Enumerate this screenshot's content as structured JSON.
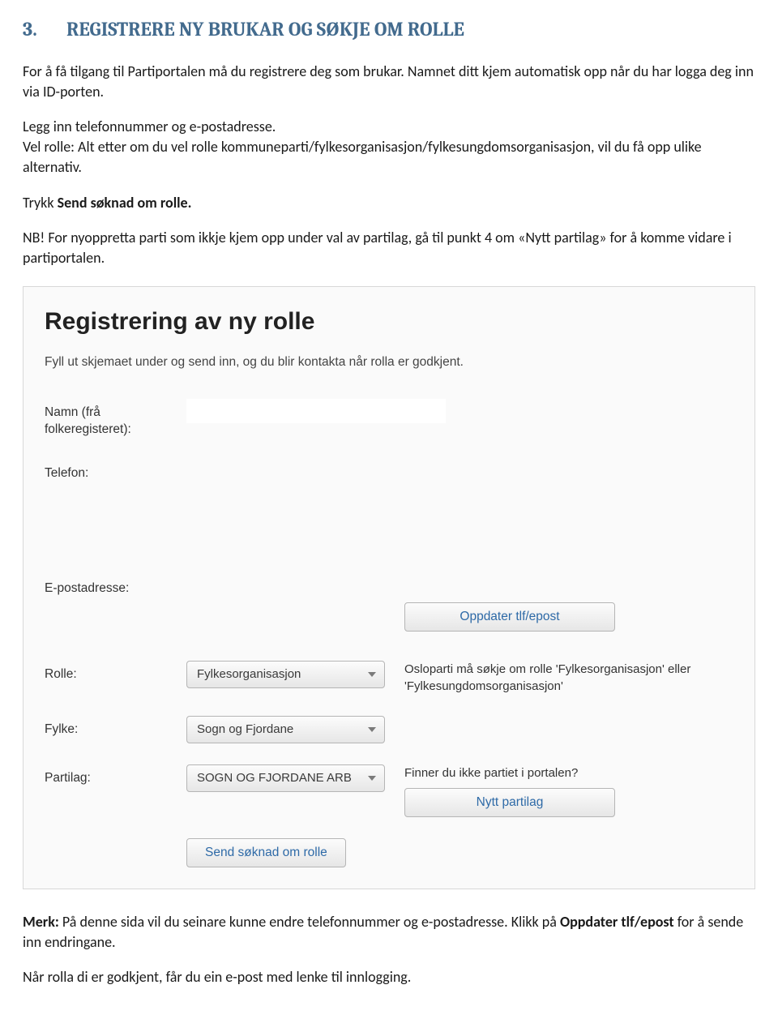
{
  "heading": {
    "number": "3.",
    "title": "REGISTRERE NY BRUKAR OG SØKJE OM ROLLE"
  },
  "paragraphs": {
    "p1": "For å få tilgang til Partiportalen må du registrere deg som brukar. Namnet ditt kjem automatisk opp når du har logga deg inn via ID-porten.",
    "p2": "Legg inn telefonnummer og e-postadresse.",
    "p3": "Vel rolle: Alt etter om du vel rolle kommuneparti/fylkesorganisasjon/fylkesungdomsorganisasjon, vil du få opp ulike alternativ.",
    "p4_pre": "Trykk ",
    "p4_bold": "Send søknad om rolle.",
    "p5": "NB! For nyoppretta parti som ikkje kjem opp under val av partilag, gå til punkt 4 om «Nytt partilag» for å komme vidare i partiportalen.",
    "merk_label": "Merk:",
    "merk_body1": " På denne sida vil du  seinare kunne endre telefonnummer og e-postadresse. Klikk på ",
    "merk_bold": "Oppdater tlf/epost",
    "merk_body2": " for å sende inn endringane.",
    "p_last": "Når rolla di er godkjent, får du ein e-post med lenke til innlogging."
  },
  "form": {
    "title": "Registrering av ny rolle",
    "intro": "Fyll ut skjemaet under og send inn, og du blir kontakta når rolla er godkjent.",
    "labels": {
      "namn": "Namn (frå folkeregisteret):",
      "telefon": "Telefon:",
      "epost": "E-postadresse:",
      "rolle": "Rolle:",
      "fylke": "Fylke:",
      "partilag": "Partilag:"
    },
    "values": {
      "rolle": "Fylkesorganisasjon",
      "fylke": "Sogn og Fjordane",
      "partilag": "SOGN OG FJORDANE ARB"
    },
    "buttons": {
      "oppdater": "Oppdater tlf/epost",
      "nytt_partilag": "Nytt partilag",
      "send": "Send søknad om rolle"
    },
    "aside": {
      "rolle": "Osloparti må søkje om rolle 'Fylkesorganisasjon' eller 'Fylkesungdomsorganisasjon'",
      "partilag": "Finner du ikke partiet i portalen?"
    }
  }
}
